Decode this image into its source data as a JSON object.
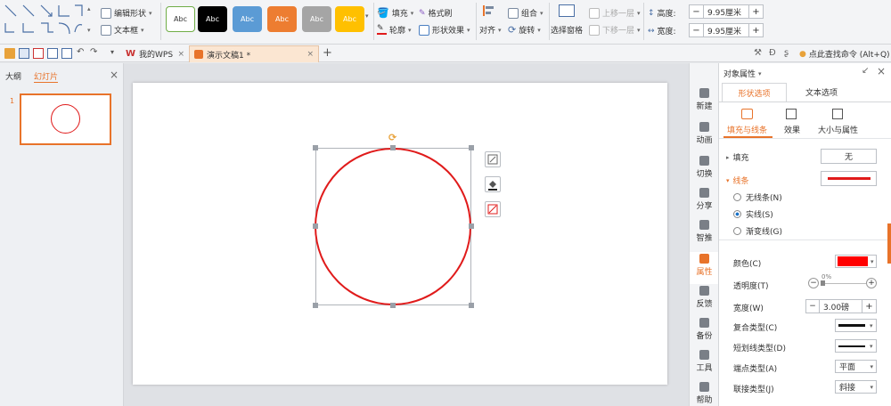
{
  "ribbon": {
    "edit_shape": "编辑形状",
    "textbox": "文本框",
    "styles": [
      {
        "label": "Abc",
        "bg": "#ffffff",
        "fg": "#333333",
        "border": "#70ad47"
      },
      {
        "label": "Abc",
        "bg": "#000000",
        "fg": "#ffffff",
        "border": "#000000"
      },
      {
        "label": "Abc",
        "bg": "#5b9bd5",
        "fg": "#ffffff",
        "border": "#5b9bd5"
      },
      {
        "label": "Abc",
        "bg": "#ed7d31",
        "fg": "#ffffff",
        "border": "#ed7d31"
      },
      {
        "label": "Abc",
        "bg": "#a5a5a5",
        "fg": "#ffffff",
        "border": "#a5a5a5"
      },
      {
        "label": "Abc",
        "bg": "#ffc000",
        "fg": "#ffffff",
        "border": "#ffc000"
      }
    ],
    "fill": "填充",
    "format_painter": "格式刷",
    "outline": "轮廓",
    "shape_effect": "形状效果",
    "align": "对齐",
    "group": "组合",
    "rotate": "旋转",
    "selection_pane": "选择窗格",
    "bring_forward": "上移一层",
    "send_backward": "下移一层",
    "height_label": "高度:",
    "height_value": "9.95厘米",
    "width_label": "宽度:",
    "width_value": "9.95厘米"
  },
  "tabs": {
    "wps_tab": "我的WPS",
    "doc_tab": "演示文稿1 *",
    "search": "点此查找命令 (Alt+Q)"
  },
  "left_panel": {
    "outline_tab": "大纲",
    "slides_tab": "幻灯片",
    "slide_number": "1"
  },
  "side_tools": [
    "新建",
    "动画",
    "切换",
    "分享",
    "智推",
    "属性",
    "反馈",
    "备份",
    "工具",
    "帮助"
  ],
  "props": {
    "title": "对象属性",
    "tab_shape": "形状选项",
    "tab_text": "文本选项",
    "sub_fill_line": "填充与线条",
    "sub_effect": "效果",
    "sub_size": "大小与属性",
    "fill_label": "填充",
    "fill_value": "无",
    "line_label": "线条",
    "no_line": "无线条(N)",
    "solid_line": "实线(S)",
    "gradient_line": "渐变线(G)",
    "color_label": "颜色(C)",
    "transparency_label": "透明度(T)",
    "transparency_value": "0%",
    "width_label": "宽度(W)",
    "width_value": "3.00磅",
    "compound_label": "复合类型(C)",
    "dash_label": "短划线类型(D)",
    "cap_label": "端点类型(A)",
    "cap_value": "平面",
    "join_label": "联接类型(J)",
    "join_value": "斜接",
    "line_color": "#ff0000"
  },
  "colors": {
    "accent": "#e8732a",
    "shape_stroke": "#e01b1b"
  }
}
